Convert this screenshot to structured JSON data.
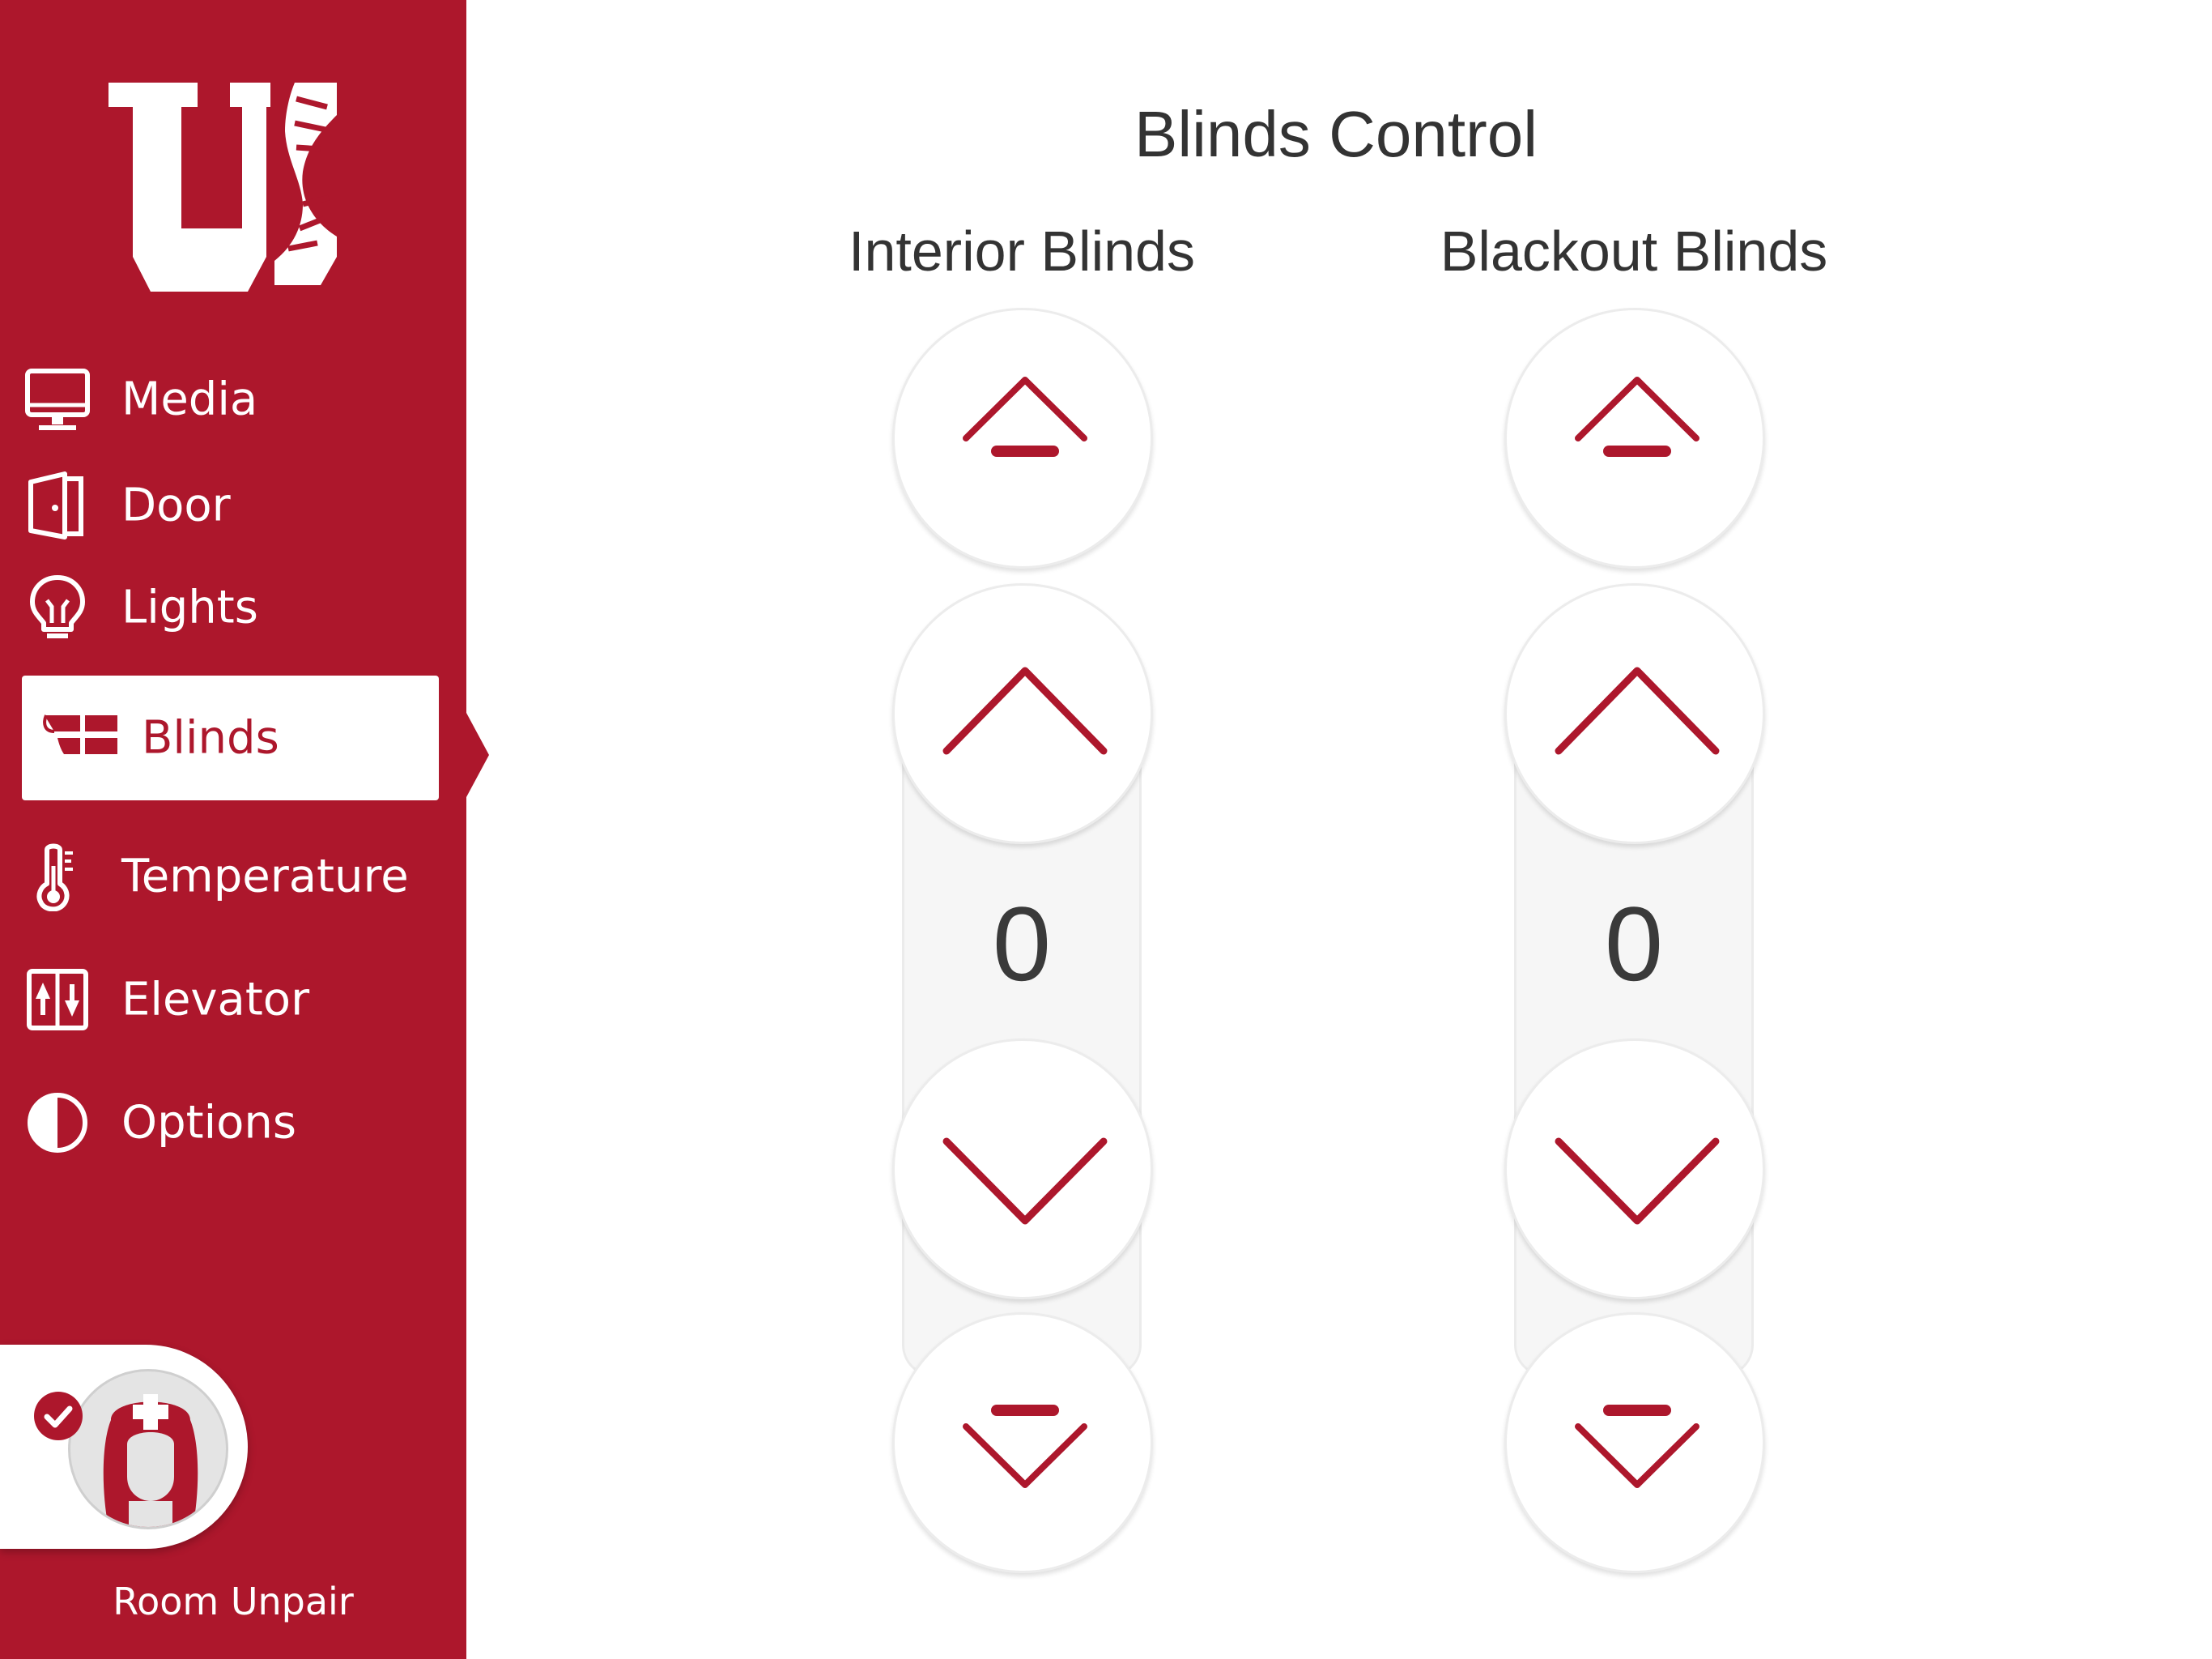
{
  "sidebar": {
    "logo": "university-dna-logo",
    "items": [
      {
        "label": "Media",
        "icon": "monitor-icon",
        "active": false
      },
      {
        "label": "Door",
        "icon": "door-icon",
        "active": false
      },
      {
        "label": "Lights",
        "icon": "lightbulb-icon",
        "active": false
      },
      {
        "label": "Blinds",
        "icon": "blinds-icon",
        "active": true
      },
      {
        "label": "Temperature",
        "icon": "thermometer-icon",
        "active": false
      },
      {
        "label": "Elevator",
        "icon": "elevator-icon",
        "active": false
      },
      {
        "label": "Options",
        "icon": "contrast-icon",
        "active": false
      }
    ],
    "unpair": {
      "label": "Room Unpair",
      "avatar": "nurse-avatar-icon",
      "status": "check-icon"
    }
  },
  "main": {
    "title": "Blinds Control",
    "columns": [
      {
        "title": "Interior Blinds",
        "value": "0"
      },
      {
        "title": "Blackout Blinds",
        "value": "0"
      }
    ]
  },
  "colors": {
    "brand": "#ad172c",
    "text": "#333333",
    "background": "#ffffff"
  }
}
